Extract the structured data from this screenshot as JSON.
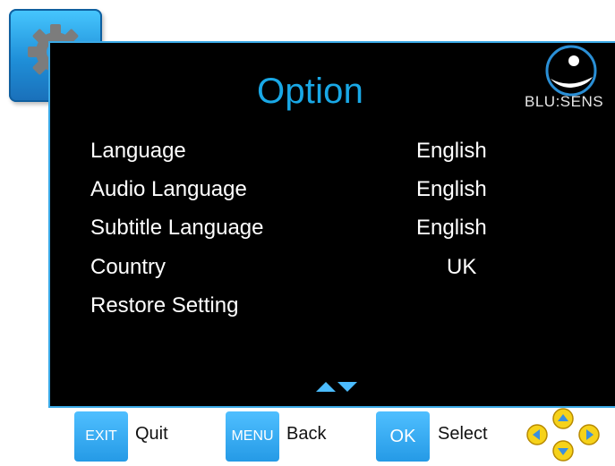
{
  "title": "Option",
  "brand": {
    "logo_text": "BLU:SENS"
  },
  "settings": [
    {
      "label": "Language",
      "value": "English"
    },
    {
      "label": "Audio Language",
      "value": "English"
    },
    {
      "label": "Subtitle Language",
      "value": "English"
    },
    {
      "label": "Country",
      "value": "UK"
    },
    {
      "label": "Restore Setting",
      "value": ""
    }
  ],
  "footer": {
    "exit_key": "EXIT",
    "exit_label": "Quit",
    "menu_key": "MENU",
    "menu_label": "Back",
    "ok_key": "OK",
    "ok_label": "Select"
  },
  "icons": {
    "settings": "gear-icon",
    "scroll": "up-down-arrows-icon",
    "navigation": "dpad-icon"
  },
  "colors": {
    "accent": "#19a8e6",
    "panel_bg": "#000000",
    "button_bg": "#259ae6",
    "dpad_yellow": "#f6d21a"
  }
}
